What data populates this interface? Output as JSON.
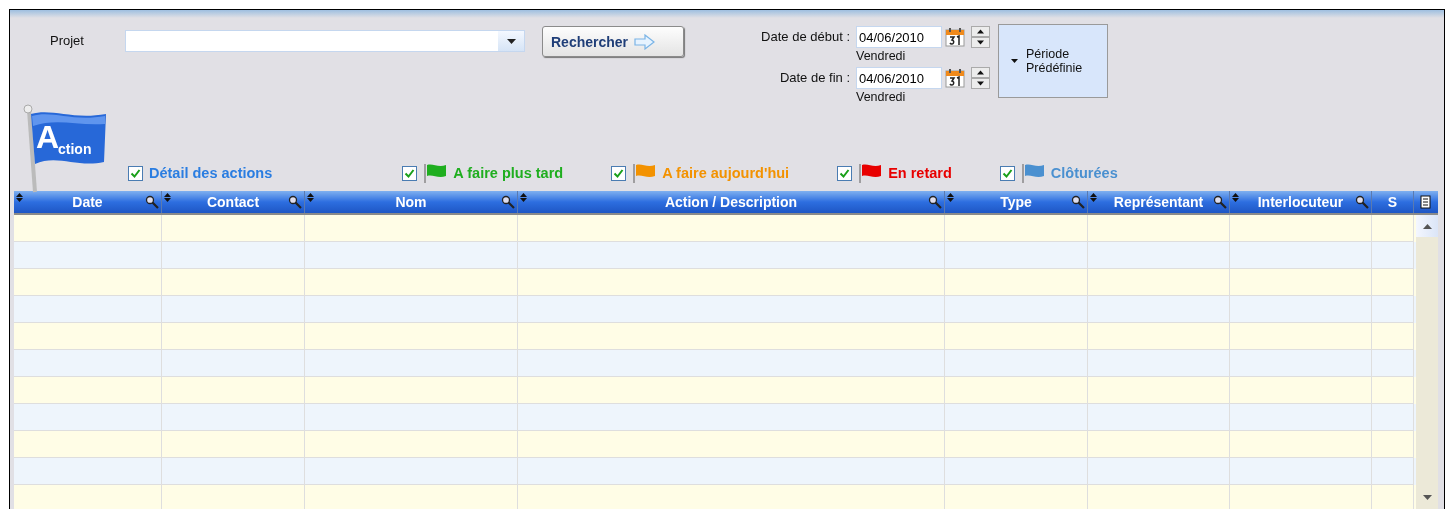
{
  "project": {
    "label": "Projet"
  },
  "search_button": {
    "label": "Rechercher"
  },
  "dates": [
    {
      "label": "Date de début :",
      "value": "04/06/2010",
      "day": "Vendredi"
    },
    {
      "label": "Date de fin :",
      "value": "04/06/2010",
      "day": "Vendredi"
    }
  ],
  "period_button": {
    "label_lines": [
      "Période",
      "Prédéfinie"
    ]
  },
  "logo": {
    "letter": "A",
    "rest": "ction"
  },
  "filters": [
    {
      "kind": "plain",
      "label": "Détail des actions",
      "checked": true,
      "color": "#2a7de1"
    },
    {
      "kind": "flag",
      "label": "A faire plus tard",
      "checked": true,
      "color": "#1fae1f"
    },
    {
      "kind": "flag",
      "label": "A faire aujourd'hui",
      "checked": true,
      "color": "#f39200"
    },
    {
      "kind": "flag",
      "label": "En retard",
      "checked": true,
      "color": "#e80000"
    },
    {
      "kind": "flag",
      "label": "Clôturées",
      "checked": true,
      "color": "#4a90d0"
    }
  ],
  "table": {
    "columns": [
      {
        "label": "Date",
        "sortable": true,
        "searchable": true
      },
      {
        "label": "Contact",
        "sortable": true,
        "searchable": true
      },
      {
        "label": "Nom",
        "sortable": true,
        "searchable": true
      },
      {
        "label": "Action / Description",
        "sortable": true,
        "searchable": true
      },
      {
        "label": "Type",
        "sortable": true,
        "searchable": true
      },
      {
        "label": "Représentant",
        "sortable": true,
        "searchable": true
      },
      {
        "label": "Interlocuteur",
        "sortable": true,
        "searchable": true
      },
      {
        "label": "S",
        "sortable": false,
        "searchable": false
      }
    ]
  }
}
